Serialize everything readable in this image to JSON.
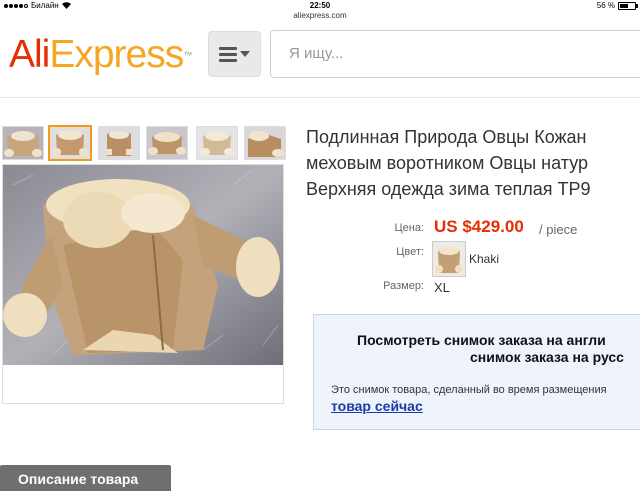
{
  "status_bar": {
    "carrier": "Билайн",
    "time": "22:50",
    "battery": "56 %",
    "battery_level": 0.56
  },
  "browser": {
    "url": "aliexpress.com"
  },
  "header": {
    "logo_part1": "Ali",
    "logo_part2": "Express",
    "logo_tm": "™",
    "search_placeholder": "Я ищу..."
  },
  "gallery": {
    "thumbnail_count": 6,
    "active_index": 1
  },
  "product": {
    "title_lines": [
      "Подлинная Природа Овцы Кожан",
      "меховым воротником Овцы натур",
      "Верхняя одежда зима теплая TP9"
    ],
    "price_label": "Цена:",
    "price": "US $429.00",
    "price_unit": "/ piece",
    "color_label": "Цвет:",
    "color_value": "Khaki",
    "size_label": "Размер:",
    "size_value": "XL"
  },
  "snapshot_notice": {
    "line1": "Посмотреть снимок заказа на англи",
    "line2": "снимок заказа на русс",
    "line3": "Это снимок товара, сделанный во время размещения",
    "link": "товар сейчас"
  },
  "tabs": {
    "description": "Описание товара"
  },
  "colors": {
    "brand_red": "#e62e04",
    "brand_orange": "#f5a623",
    "active_thumb": "#f29b18",
    "link": "#1a3aa8"
  }
}
